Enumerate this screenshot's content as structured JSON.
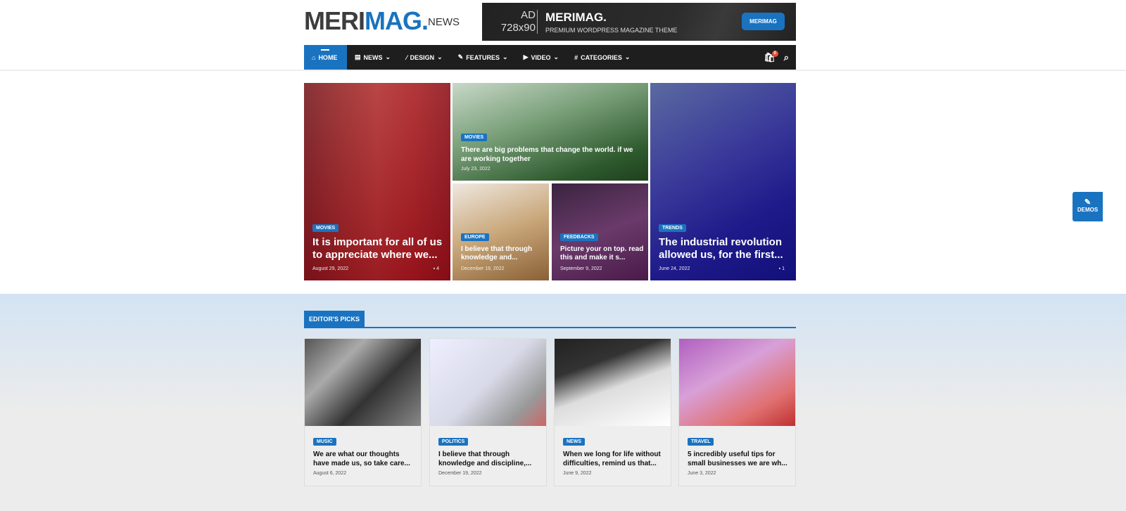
{
  "logo": {
    "part1": "MERI",
    "part2": "MAG.",
    "suffix": "NEWS"
  },
  "ad": {
    "label1": "AD",
    "label2": "728x90",
    "title": "MERIMAG.",
    "subtitle": "PREMIUM WORDPRESS MAGAZINE THEME",
    "button": "MERIMAG"
  },
  "nav": {
    "items": [
      {
        "label": "HOME",
        "icon": "home-icon"
      },
      {
        "label": "NEWS",
        "icon": "newspaper-icon"
      },
      {
        "label": "DESIGN",
        "icon": "wand-icon"
      },
      {
        "label": "FEATURES",
        "icon": "feather-icon"
      },
      {
        "label": "VIDEO",
        "icon": "play-icon"
      },
      {
        "label": "CATEGORIES",
        "icon": "hashtag-icon"
      }
    ],
    "cart_count": "0"
  },
  "hero": [
    {
      "category": "MOVIES",
      "title": "It is important for all of us to appreciate where we...",
      "date": "August 29, 2022",
      "comments": "4"
    },
    {
      "category": "MOVIES",
      "title": "There are big problems that change the world. if we are working together",
      "date": "July 23, 2022"
    },
    {
      "category": "EUROPE",
      "title": "I believe that through knowledge and...",
      "date": "December 19, 2022"
    },
    {
      "category": "FEEDBACKS",
      "title": "Picture your on top. read this and make it s...",
      "date": "September 9, 2022"
    },
    {
      "category": "TRENDS",
      "title": "The industrial revolution allowed us, for the first...",
      "date": "June 24, 2022",
      "comments": "1"
    }
  ],
  "editors": {
    "heading": "EDITOR'S PICKS",
    "cards": [
      {
        "category": "MUSIC",
        "title": "We are what our thoughts have made us, so take care...",
        "date": "August 6, 2022"
      },
      {
        "category": "POLITICS",
        "title": "I believe that through knowledge and discipline,...",
        "date": "December 19, 2022"
      },
      {
        "category": "NEWS",
        "title": "When we long for life without difficulties, remind us that...",
        "date": "June 9, 2022"
      },
      {
        "category": "TRAVEL",
        "title": "5 incredibly useful tips for small businesses we are wh...",
        "date": "June 3, 2022"
      }
    ]
  },
  "demos": "DEMOS",
  "colors": {
    "accent": "#1a73c0",
    "nav": "#1e1e1e"
  }
}
